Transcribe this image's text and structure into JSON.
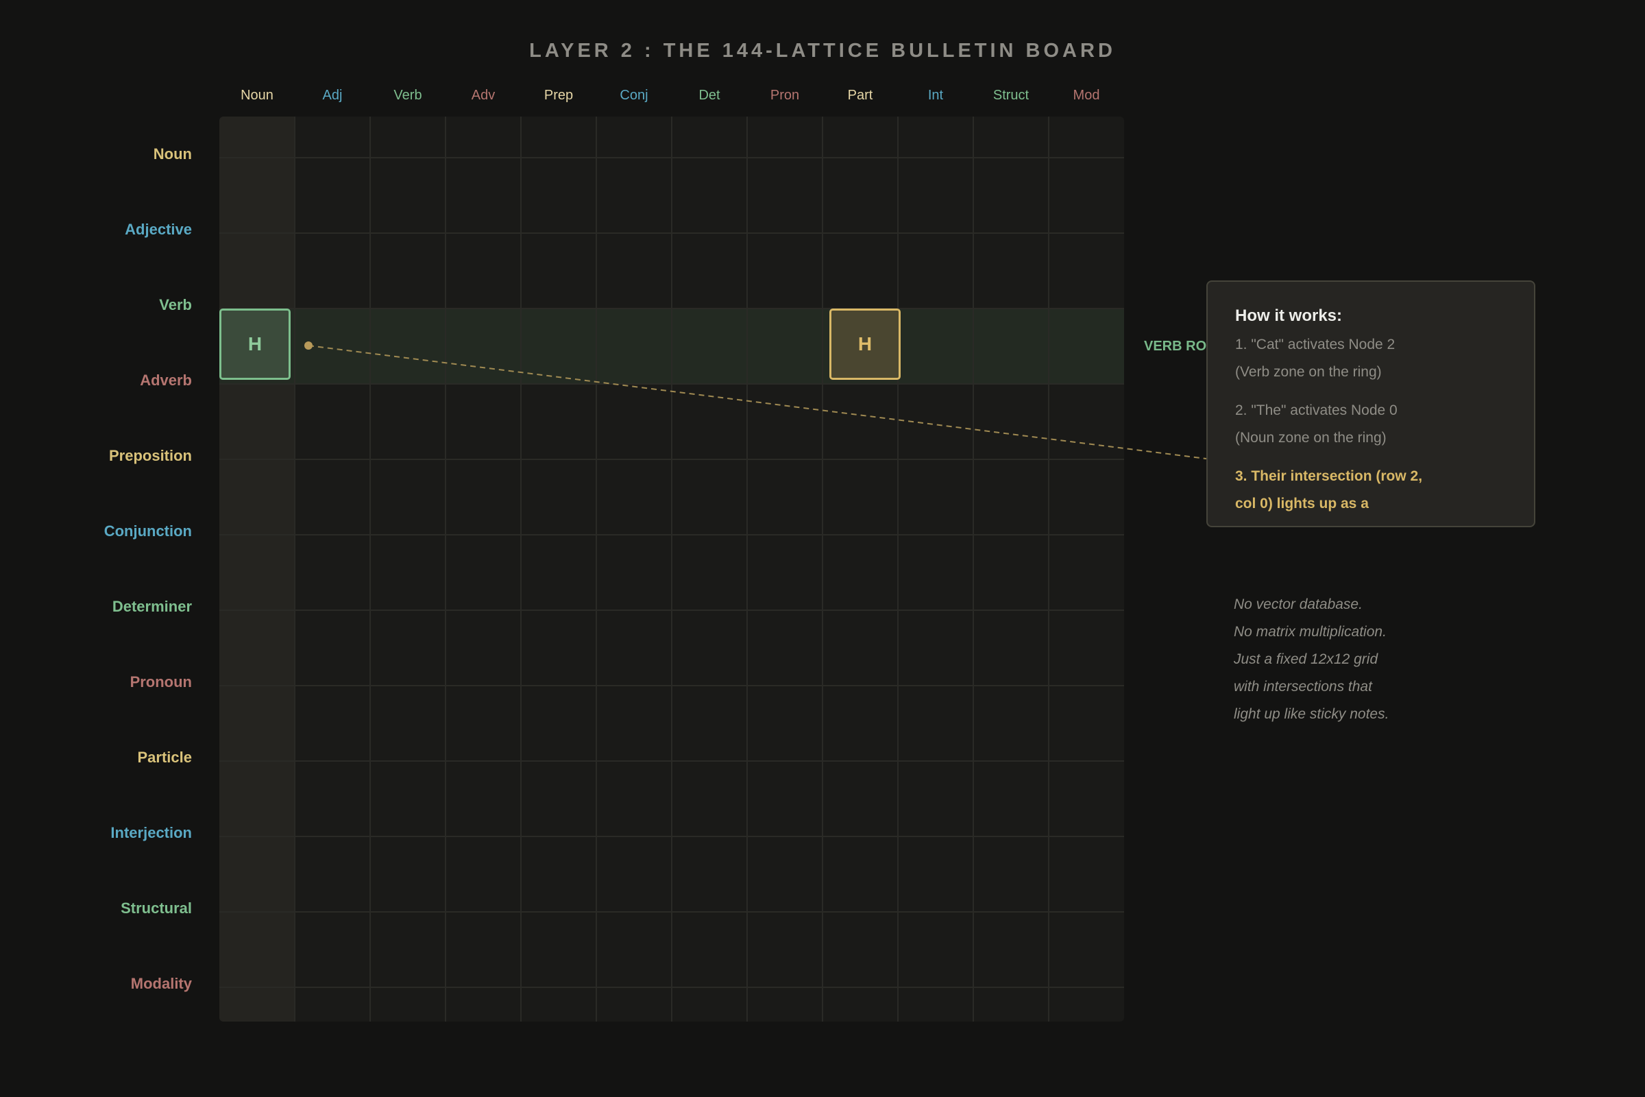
{
  "title": "LAYER 2 : THE 144-LATTICE BULLETIN BOARD",
  "columns": [
    {
      "label": "Noun",
      "color": "#e6d6a6"
    },
    {
      "label": "Adj",
      "color": "#5aa9c4"
    },
    {
      "label": "Verb",
      "color": "#7fbf8f"
    },
    {
      "label": "Adv",
      "color": "#b57570"
    },
    {
      "label": "Prep",
      "color": "#e6d6a6"
    },
    {
      "label": "Conj",
      "color": "#5aa9c4"
    },
    {
      "label": "Det",
      "color": "#7fbf8f"
    },
    {
      "label": "Pron",
      "color": "#b57570"
    },
    {
      "label": "Part",
      "color": "#e6d6a6"
    },
    {
      "label": "Int",
      "color": "#5aa9c4"
    },
    {
      "label": "Struct",
      "color": "#7fbf8f"
    },
    {
      "label": "Mod",
      "color": "#b57570"
    }
  ],
  "rows": [
    {
      "label": "Noun",
      "color": "#d9c27a"
    },
    {
      "label": "Adjective",
      "color": "#5aa9c4"
    },
    {
      "label": "Verb",
      "color": "#7fbf8f"
    },
    {
      "label": "Adverb",
      "color": "#b57570"
    },
    {
      "label": "Preposition",
      "color": "#d9c27a"
    },
    {
      "label": "Conjunction",
      "color": "#5aa9c4"
    },
    {
      "label": "Determiner",
      "color": "#7fbf8f"
    },
    {
      "label": "Pronoun",
      "color": "#b57570"
    },
    {
      "label": "Particle",
      "color": "#d9c27a"
    },
    {
      "label": "Interjection",
      "color": "#5aa9c4"
    },
    {
      "label": "Structural",
      "color": "#7fbf8f"
    },
    {
      "label": "Modality",
      "color": "#b57570"
    }
  ],
  "highlighted_cells": [
    {
      "row": 2,
      "col": 0,
      "label": "H",
      "color": "#7dbf8d"
    },
    {
      "row": 2,
      "col": 7,
      "label": "H",
      "color": "#d9b866"
    }
  ],
  "verb_row_label": "VERB ROW",
  "panel": {
    "title": "How it works:",
    "step1_line1": "1. \"Cat\" activates Node 2",
    "step1_line2": "(Verb zone on the ring)",
    "step2_line1": "2. \"The\" activates Node 0",
    "step2_line2": "(Noun zone on the ring)",
    "step3_line1": "3. Their intersection (row 2,",
    "step3_line2": "col 0) lights up as a"
  },
  "note": [
    "No vector database.",
    "No matrix multiplication.",
    "Just a fixed 12x12 grid",
    "with intersections that",
    "light up like sticky notes."
  ]
}
